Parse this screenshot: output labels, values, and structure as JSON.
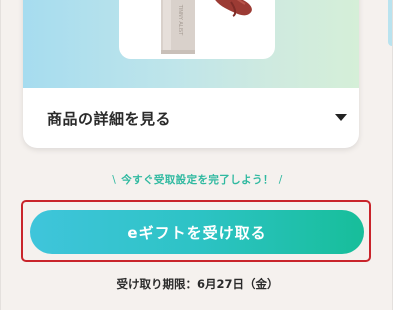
{
  "product": {
    "brand_text": "TINNY ALIST"
  },
  "details": {
    "label": "商品の詳細を見る"
  },
  "prompt": {
    "left_slash": "\\",
    "text": "今すぐ受取設定を完了しよう！",
    "right_slash": "/"
  },
  "cta": {
    "label": "eギフトを受け取る"
  },
  "deadline": {
    "text": "受け取り期限：6月27日（金）"
  },
  "colors": {
    "accent_teal": "#2fb9a0",
    "button_gradient_start": "#3fc5db",
    "button_gradient_end": "#17be9a",
    "highlight_red": "#c9242b"
  }
}
